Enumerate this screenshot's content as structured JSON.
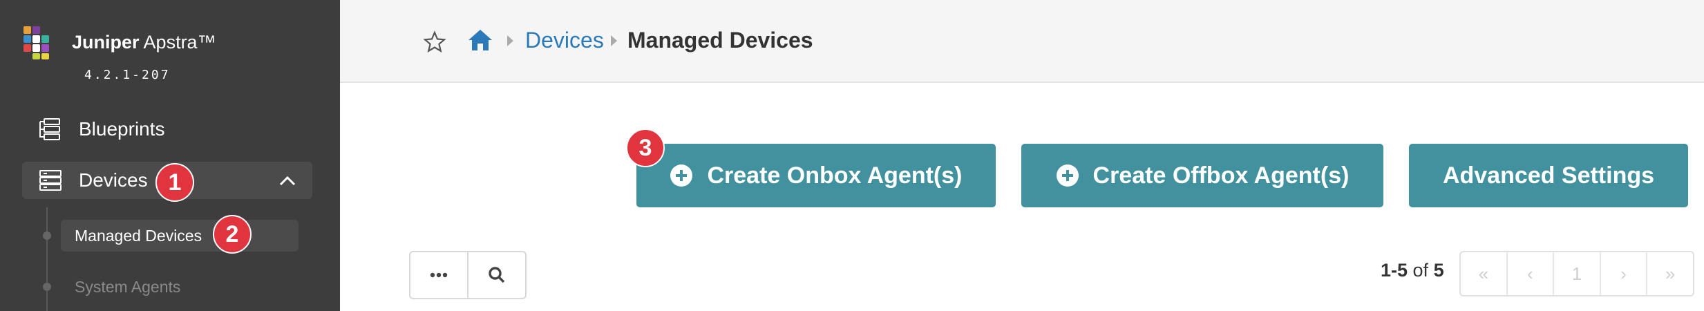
{
  "app": {
    "brand_bold": "Juniper",
    "brand_rest": " Apstra™",
    "version": "4.2.1-207"
  },
  "sidebar": {
    "items": [
      {
        "label": "Blueprints",
        "icon": "blueprints-icon"
      },
      {
        "label": "Devices",
        "icon": "devices-icon",
        "expanded": true
      }
    ],
    "sub_items": [
      {
        "label": "Managed Devices",
        "active": true
      },
      {
        "label": "System Agents",
        "active": false
      }
    ]
  },
  "breadcrumb": {
    "link": "Devices",
    "current": "Managed Devices"
  },
  "actions": {
    "onbox_label": "Create Onbox Agent(s)",
    "offbox_label": "Create Offbox Agent(s)",
    "advanced_label": "Advanced Settings"
  },
  "toolbar": {
    "more_label": "•••"
  },
  "pagination": {
    "range": "1-5",
    "of_word": " of ",
    "total": "5",
    "first": "«",
    "prev": "‹",
    "page": "1",
    "next": "›",
    "last": "»"
  },
  "annotations": {
    "step1": "1",
    "step2": "2",
    "step3": "3"
  },
  "colors": {
    "sidebar_bg": "#3d3d3d",
    "accent_button": "#41929e",
    "link": "#2b79b8",
    "badge": "#e0343f"
  }
}
